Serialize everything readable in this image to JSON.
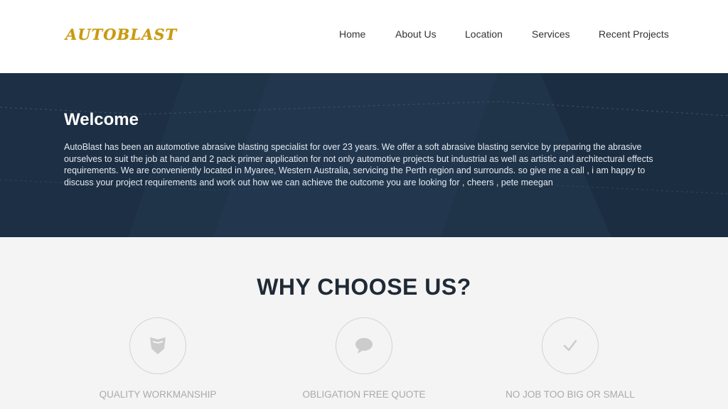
{
  "header": {
    "logo": "AUTOBLAST",
    "nav": [
      {
        "label": "Home"
      },
      {
        "label": "About Us"
      },
      {
        "label": "Location"
      },
      {
        "label": "Services"
      },
      {
        "label": "Recent Projects"
      }
    ]
  },
  "hero": {
    "title": "Welcome",
    "body": "AutoBlast has been an automotive abrasive blasting specialist for over 23 years. We offer a soft abrasive blasting service by preparing the abrasive ourselves to suit the job at hand and 2 pack primer application for not only automotive projects but industrial as well as artistic and architectural effects requirements. We are conveniently located in Myaree, Western Australia, servicing the Perth region and surrounds. so give me a call , i am happy to discuss your project requirements and work out how we can achieve the outcome you are looking for , cheers , pete meegan"
  },
  "why": {
    "title": "WHY CHOOSE US?",
    "features": [
      {
        "label": "QUALITY WORKMANSHIP",
        "icon": "shield-icon"
      },
      {
        "label": "OBLIGATION FREE QUOTE",
        "icon": "speech-bubble-icon"
      },
      {
        "label": "NO JOB TOO BIG OR SMALL",
        "icon": "checkmark-icon"
      }
    ]
  },
  "colors": {
    "logo": "#c89a12",
    "hero_bg": "#1f3349",
    "icon": "#cccccc"
  }
}
